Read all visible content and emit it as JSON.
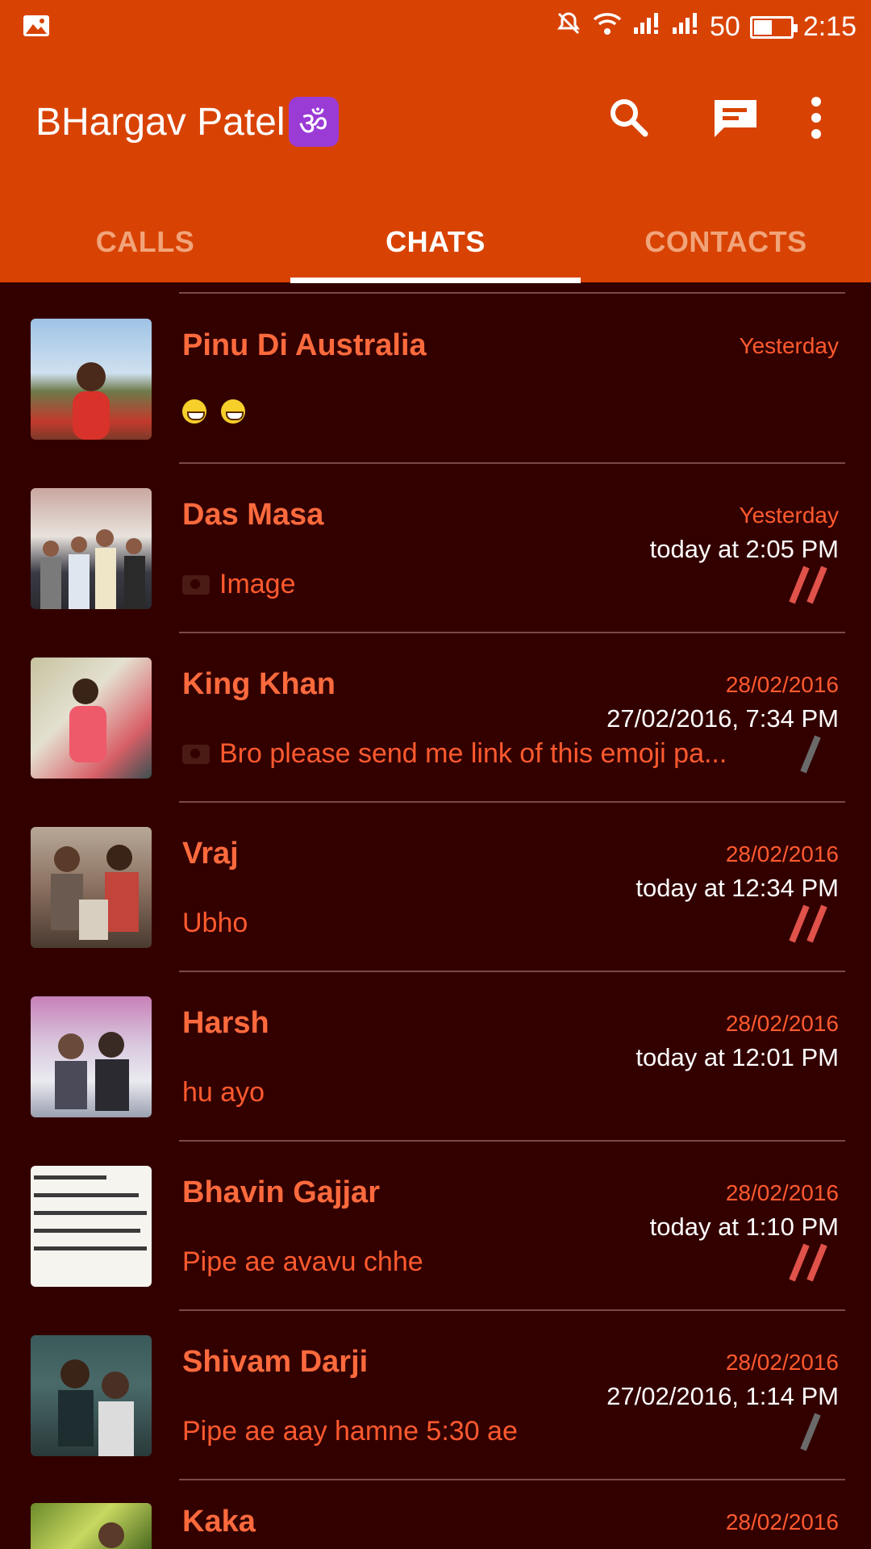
{
  "status_bar": {
    "battery": "50",
    "time": "2:15",
    "battery_level": 0.5
  },
  "header": {
    "title": "BHargav Patel",
    "title_emoji": "ॐ"
  },
  "tabs": [
    {
      "label": "CALLS",
      "active": false
    },
    {
      "label": "CHATS",
      "active": true
    },
    {
      "label": "CONTACTS",
      "active": false
    }
  ],
  "chats": [
    {
      "name": "Pinu Di Australia",
      "date": "Yesterday",
      "status": "",
      "message": "",
      "message_emoji": "grinning-emoji x2",
      "ticks": ""
    },
    {
      "name": "Das Masa",
      "date": "Yesterday",
      "status": "today at 2:05 PM",
      "message": "Image",
      "camera": true,
      "ticks": "double"
    },
    {
      "name": "King Khan",
      "date": "28/02/2016",
      "status": "27/02/2016, 7:34 PM",
      "message": "Bro please send me link of this emoji pa...",
      "camera": true,
      "ticks": "single"
    },
    {
      "name": "Vraj",
      "date": "28/02/2016",
      "status": "today at 12:34 PM",
      "message": "Ubho",
      "ticks": "double"
    },
    {
      "name": "Harsh",
      "date": "28/02/2016",
      "status": "today at 12:01 PM",
      "message": "hu ayo",
      "ticks": ""
    },
    {
      "name": "Bhavin Gajjar",
      "date": "28/02/2016",
      "status": "today at 1:10 PM",
      "message": "Pipe ae avavu chhe",
      "ticks": "double"
    },
    {
      "name": "Shivam Darji",
      "date": "28/02/2016",
      "status": "27/02/2016, 1:14 PM",
      "message": "Pipe ae aay hamne 5:30 ae",
      "ticks": "single"
    },
    {
      "name": "Kaka",
      "date": "28/02/2016",
      "status": "",
      "message": "",
      "ticks": ""
    }
  ],
  "colors": {
    "accent": "#d84304",
    "background": "#330000",
    "name": "#ff6a3d"
  }
}
